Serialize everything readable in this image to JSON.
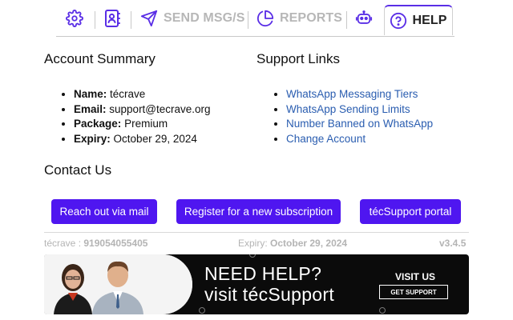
{
  "nav": {
    "settings_icon": "gear-icon",
    "contacts_icon": "contact-book-icon",
    "send_icon": "paper-plane-icon",
    "send_label": "SEND MSG/S",
    "reports_icon": "pie-chart-icon",
    "reports_label": "REPORTS",
    "bot_icon": "robot-icon",
    "help_icon": "question-circle-icon",
    "help_label": "HELP",
    "active_tab": "HELP",
    "accent_color": "#5a2ee6"
  },
  "account": {
    "title": "Account Summary",
    "name_label": "Name:",
    "name_value": "técrave",
    "email_label": "Email:",
    "email_value": "support@tecrave.org",
    "package_label": "Package:",
    "package_value": "Premium",
    "expiry_label": "Expiry:",
    "expiry_value": "October 29, 2024"
  },
  "support": {
    "title": "Support Links",
    "links": [
      "WhatsApp Messaging Tiers",
      "WhatsApp Sending Limits",
      "Number Banned on WhatsApp",
      "Change Account"
    ]
  },
  "contact": {
    "title": "Contact Us",
    "buttons": [
      "Reach out via mail",
      "Register for a new subscription",
      "técSupport portal"
    ],
    "button_color": "#4f16f0"
  },
  "footer": {
    "user": "técrave",
    "phone": "919054055405",
    "expiry_label": "Expiry:",
    "expiry_value": "October 29, 2024",
    "version": "v3.4.5"
  },
  "banner": {
    "title": "NEED HELP?",
    "subtitle": "visit técSupport",
    "cta_heading": "VISIT US",
    "cta_button": "GET SUPPORT"
  }
}
